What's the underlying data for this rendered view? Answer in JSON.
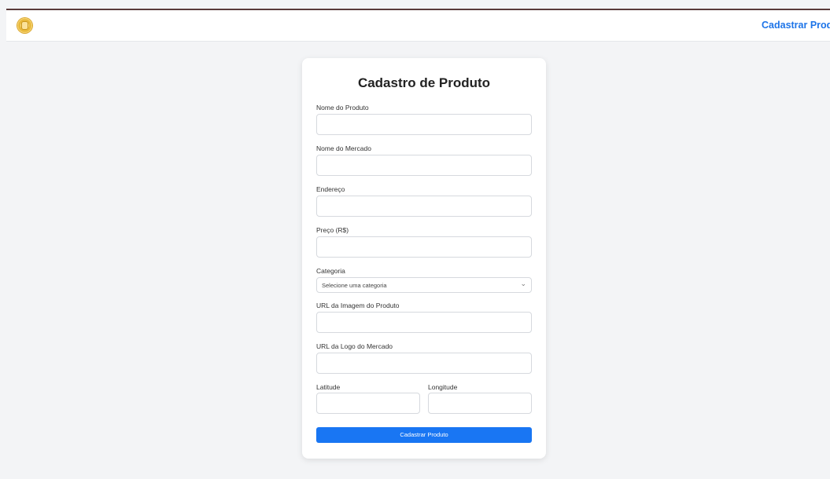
{
  "header": {
    "nav_link": "Cadastrar Produto"
  },
  "form": {
    "title": "Cadastro de Produto",
    "fields": {
      "product_name": {
        "label": "Nome do Produto",
        "value": ""
      },
      "market_name": {
        "label": "Nome do Mercado",
        "value": ""
      },
      "address": {
        "label": "Endereço",
        "value": ""
      },
      "price": {
        "label": "Preço (R$)",
        "value": ""
      },
      "category": {
        "label": "Categoria",
        "selected": "Selecione uma categoria"
      },
      "product_image_url": {
        "label": "URL da Imagem do Produto",
        "value": ""
      },
      "market_logo_url": {
        "label": "URL da Logo do Mercado",
        "value": ""
      },
      "latitude": {
        "label": "Latitude",
        "value": ""
      },
      "longitude": {
        "label": "Longitude",
        "value": ""
      }
    },
    "submit_label": "Cadastrar Produto"
  },
  "icons": {
    "logo": "logo-icon",
    "select_chevron": "chevron-down-icon"
  },
  "colors": {
    "accent": "#1976f3",
    "nav_link": "#1d74e8",
    "header_border": "#5a3a3a",
    "logo": "#e8b93c"
  }
}
